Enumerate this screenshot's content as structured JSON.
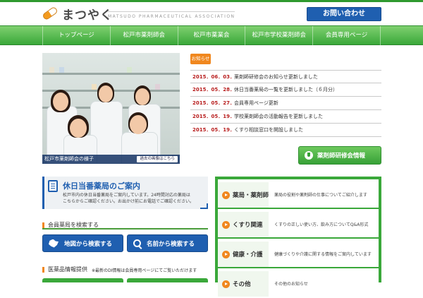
{
  "header": {
    "logo_text": "まつやく",
    "logo_sub": "MATSUDO PHARMACEUTICAL ASSOCIATION",
    "contact_label": "お問い合わせ"
  },
  "nav": {
    "items": [
      {
        "label": "トップページ"
      },
      {
        "label": "松戸市薬剤師会"
      },
      {
        "label": "松戸市薬業会"
      },
      {
        "label": "松戸市学校薬剤師会"
      },
      {
        "label": "会員専用ページ"
      }
    ]
  },
  "photo": {
    "caption": "松戸市薬剤師会の様子",
    "past_label": "過去の画像はこちら"
  },
  "news": {
    "tag": "お知らせ",
    "items": [
      {
        "date": "2015．06．03．",
        "title": "薬剤師研修会のお知らせ更新しました"
      },
      {
        "date": "2015．05．28．",
        "title": "休日当番薬局の一覧を更新しました（６月分）"
      },
      {
        "date": "2015．05．27．",
        "title": "会員専用ページ更新"
      },
      {
        "date": "2015．05．19．",
        "title": "学校薬剤師会の活動報告を更新しました"
      },
      {
        "date": "2015．05．19．",
        "title": "くすり相談窓口を開設しました"
      }
    ],
    "seminar_label": "薬剤師研修会情報"
  },
  "holiday": {
    "title": "休日当番薬局のご案内",
    "desc_line1": "松戸市内の休日当番薬局をご案内しています。24時間対応の薬局は",
    "desc_line2": "こちらからご確認ください。お出かけ前にお電話でご確認ください。"
  },
  "pharmacy_search": {
    "heading": "会員薬局を検索する",
    "map_label": "地図から検索する",
    "name_label": "名前から検索する"
  },
  "info": {
    "heading": "医薬品情報提供",
    "note": "※最新のDI情報は会員専用ページにてご覧いただけます"
  },
  "categories": [
    {
      "label": "薬局・薬剤師",
      "desc": "薬局の役割や薬剤師の仕事についてご紹介します"
    },
    {
      "label": "くすり関連",
      "desc": "くすりの正しい使い方、飲み方についてQ&A形式"
    },
    {
      "label": "健康・介護",
      "desc": "健康づくりや介護に関する情報をご案内しています"
    },
    {
      "label": "その他",
      "desc": "その他のお知らせ"
    }
  ],
  "colors": {
    "brand_green": "#3aa83a",
    "brand_blue": "#1f5fb0",
    "accent_orange": "#f0871e",
    "date_red": "#b81d1d"
  }
}
